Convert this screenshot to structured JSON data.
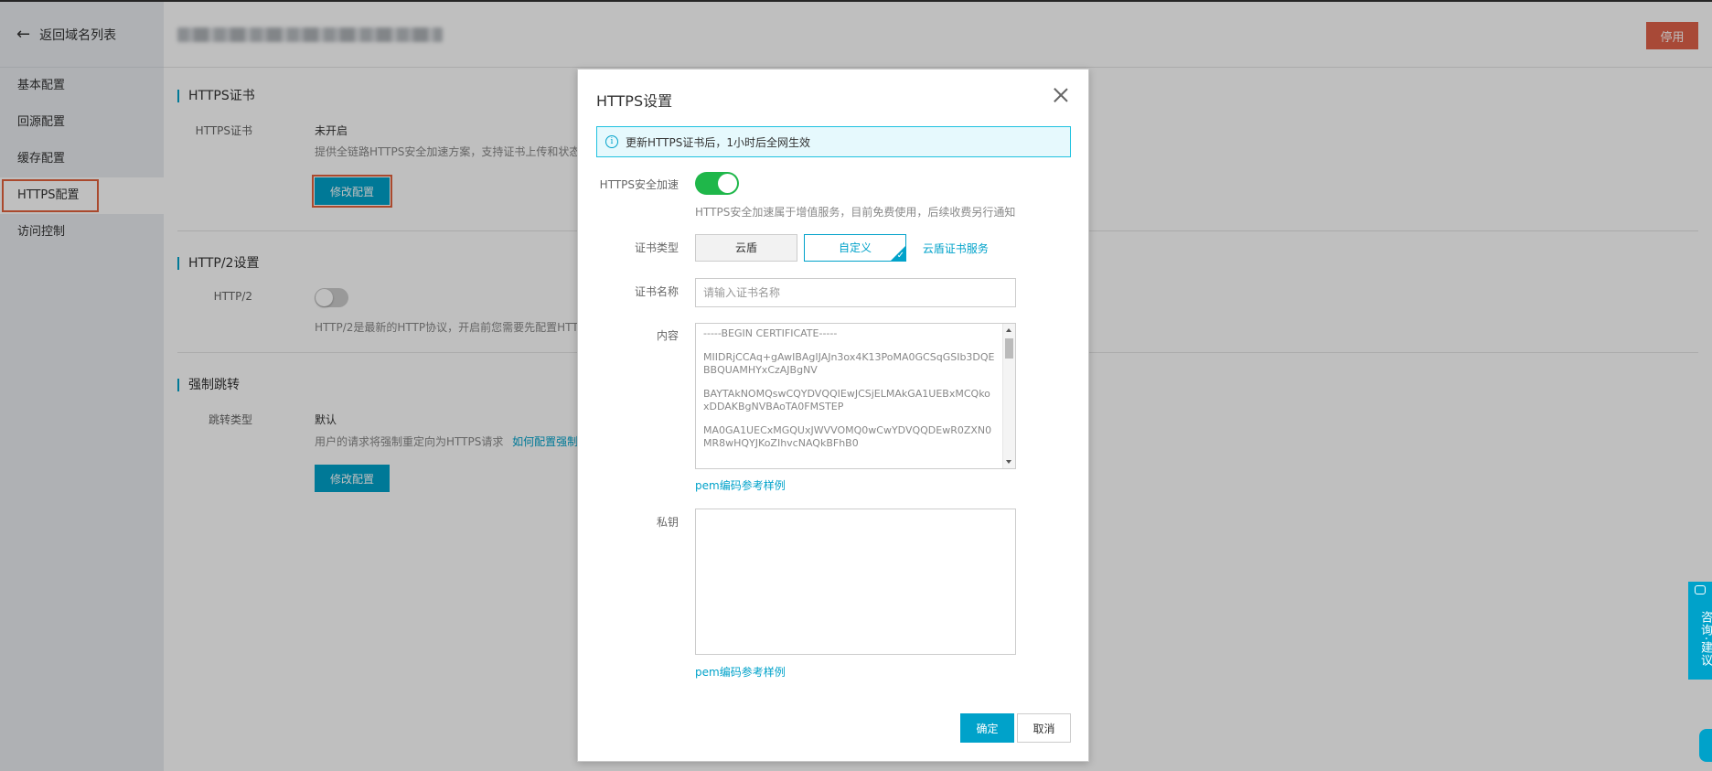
{
  "sidebar": {
    "back_label": "返回域名列表",
    "items": [
      {
        "label": "基本配置"
      },
      {
        "label": "回源配置"
      },
      {
        "label": "缓存配置"
      },
      {
        "label": "HTTPS配置"
      },
      {
        "label": "访问控制"
      }
    ]
  },
  "header": {
    "stop_label": "停用"
  },
  "https_section": {
    "title": "HTTPS证书",
    "label": "HTTPS证书",
    "status": "未开启",
    "description": "提供全链路HTTPS安全加速方案，支持证书上传和状态",
    "edit_label": "修改配置"
  },
  "http2_section": {
    "title": "HTTP/2设置",
    "label": "HTTP/2",
    "description": "HTTP/2是最新的HTTP协议，开启前您需要先配置HTT"
  },
  "redirect_section": {
    "title": "强制跳转",
    "label": "跳转类型",
    "value": "默认",
    "description": "用户的请求将强制重定向为HTTPS请求",
    "link": "如何配置强制",
    "edit_label": "修改配置"
  },
  "modal": {
    "title": "HTTPS设置",
    "notice": "更新HTTPS证书后，1小时后全网生效",
    "https_accel_label": "HTTPS安全加速",
    "https_accel_hint": "HTTPS安全加速属于增值服务，目前免费使用，后续收费另行通知",
    "cert_type_label": "证书类型",
    "cert_type_options": [
      "云盾",
      "自定义"
    ],
    "cert_service_link": "云盾证书服务",
    "cert_name_label": "证书名称",
    "cert_name_placeholder": "请输入证书名称",
    "content_label": "内容",
    "content_lines": [
      "-----BEGIN CERTIFICATE-----",
      "MIIDRjCCAq+gAwIBAgIJAJn3ox4K13PoMA0GCSqGSIb3DQEBBQUAMHYxCzAJBgNV",
      "BAYTAkNOMQswCQYDVQQIEwJCSjELMAkGA1UEBxMCQkoxDDAKBgNVBAoTA0FMSTEP",
      "MA0GA1UECxMGQUxJWVVOMQ0wCwYDVQQDEwR0ZXN0MR8wHQYJKoZIhvcNAQkBFhB0"
    ],
    "pem_link_1": "pem编码参考样例",
    "private_key_label": "私钥",
    "pem_link_2": "pem编码参考样例",
    "ok_label": "确定",
    "cancel_label": "取消"
  },
  "feedback": {
    "label": "咨询·建议"
  }
}
